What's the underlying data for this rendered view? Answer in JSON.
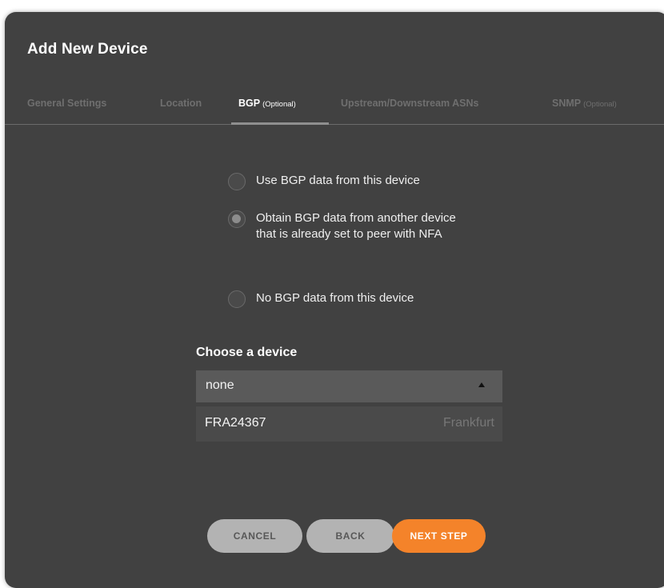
{
  "dialog": {
    "title": "Add New Device"
  },
  "tabs": [
    {
      "label": "General Settings",
      "optional": ""
    },
    {
      "label": "Location",
      "optional": ""
    },
    {
      "label": "BGP",
      "optional": "(Optional)",
      "active": true
    },
    {
      "label": "Upstream/Downstream ASNs",
      "optional": ""
    },
    {
      "label": "SNMP",
      "optional": "(Optional)"
    }
  ],
  "bgp_options": [
    {
      "label": "Use BGP data from this device",
      "selected": false
    },
    {
      "label": "Obtain BGP data from another device that is already set to peer with NFA",
      "selected": true
    },
    {
      "label": "No BGP data from this device",
      "selected": false
    }
  ],
  "device_chooser": {
    "title": "Choose a device",
    "selected_value": "none",
    "options": [
      {
        "name": "FRA24367",
        "location": "Frankfurt"
      }
    ]
  },
  "footer": {
    "cancel_label": "CANCEL",
    "back_label": "BACK",
    "next_label": "NEXT STEP"
  },
  "colors": {
    "dialog_bg": "#414141",
    "accent": "#f4832a",
    "secondary_button": "#b3b3b3"
  }
}
